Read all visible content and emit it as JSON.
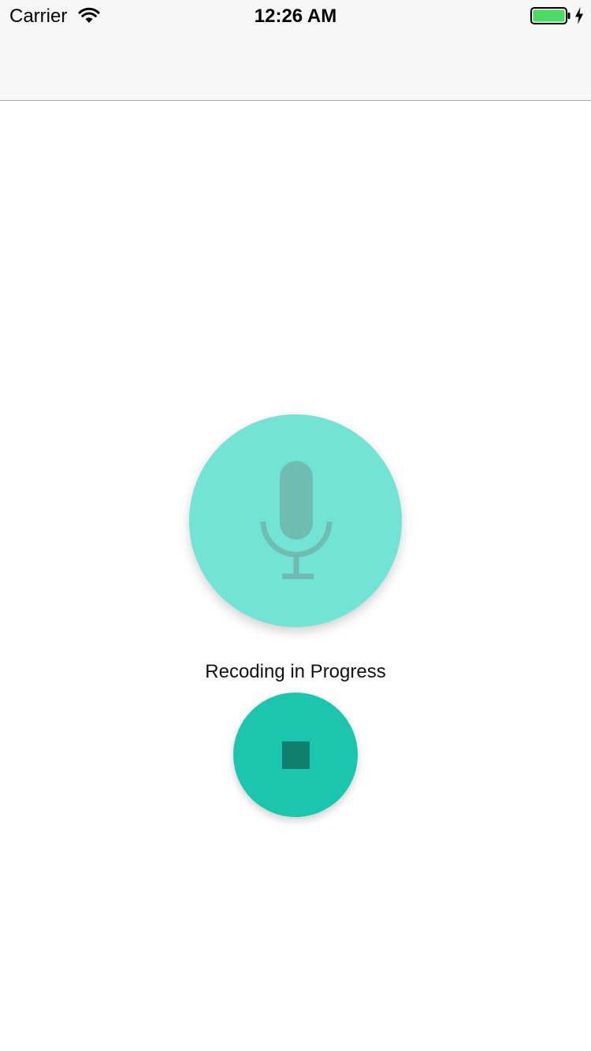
{
  "status_bar": {
    "carrier": "Carrier",
    "time": "12:26 AM",
    "wifi_icon": "wifi-icon",
    "battery_icon": "battery-icon",
    "charging_icon": "bolt-icon"
  },
  "main": {
    "mic_icon": "microphone-icon",
    "status_text": "Recoding in Progress",
    "stop_icon": "stop-icon"
  },
  "colors": {
    "mic_circle": "#72e3d4",
    "mic_glyph": "#6fbcb3",
    "stop_button": "#1bc5ae",
    "stop_glyph": "#127e6e",
    "battery_fill": "#4cd964"
  }
}
